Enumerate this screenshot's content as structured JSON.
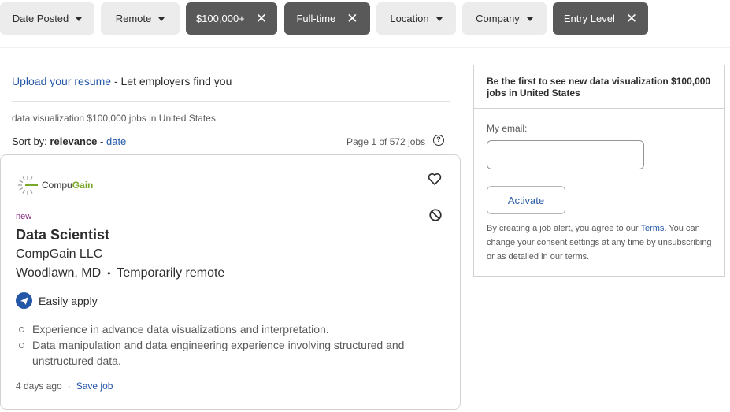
{
  "filters": {
    "date_posted": "Date Posted",
    "remote": "Remote",
    "salary": "$100,000+",
    "job_type": "Full-time",
    "location": "Location",
    "company": "Company",
    "experience": "Entry Level"
  },
  "upload": {
    "link_text": "Upload your resume",
    "rest_text": " - Let employers find you"
  },
  "search": {
    "query_summary": "data visualization $100,000 jobs in United States",
    "sort_label": "Sort by: ",
    "sort_active": "relevance",
    "sort_sep": " - ",
    "sort_alt": "date",
    "page_info": "Page 1 of 572 jobs"
  },
  "job": {
    "logo_text_a": "Compu",
    "logo_text_b": "Gain",
    "badge": "new",
    "title": "Data Scientist",
    "company": "CompGain LLC",
    "location": "Woodlawn, MD",
    "location_sep": "•",
    "remote": "Temporarily remote",
    "apply_label": "Easily apply",
    "snippets": [
      "Experience in advance data visualizations and interpretation.",
      "Data manipulation and data engineering experience involving structured and unstructured data."
    ],
    "posted": "4 days ago",
    "meta_sep": "·",
    "save_label": "Save job"
  },
  "alert": {
    "heading": "Be the first to see new data visualization $100,000 jobs in United States",
    "email_label": "My email:",
    "email_value": "",
    "activate_label": "Activate",
    "terms_pre": "By creating a job alert, you agree to our ",
    "terms_link": "Terms",
    "terms_post": ". You can change your consent settings at any time by unsubscribing or as detailed in our terms."
  },
  "colors": {
    "link": "#2557a7",
    "active_pill": "#595959",
    "inactive_pill": "#ececec",
    "new_badge": "#892e85",
    "logo_accent": "#7aa82b"
  },
  "icons": [
    "caret-down-icon",
    "close-icon",
    "help-icon",
    "heart-icon",
    "block-icon",
    "send-icon",
    "compugain-logo"
  ]
}
